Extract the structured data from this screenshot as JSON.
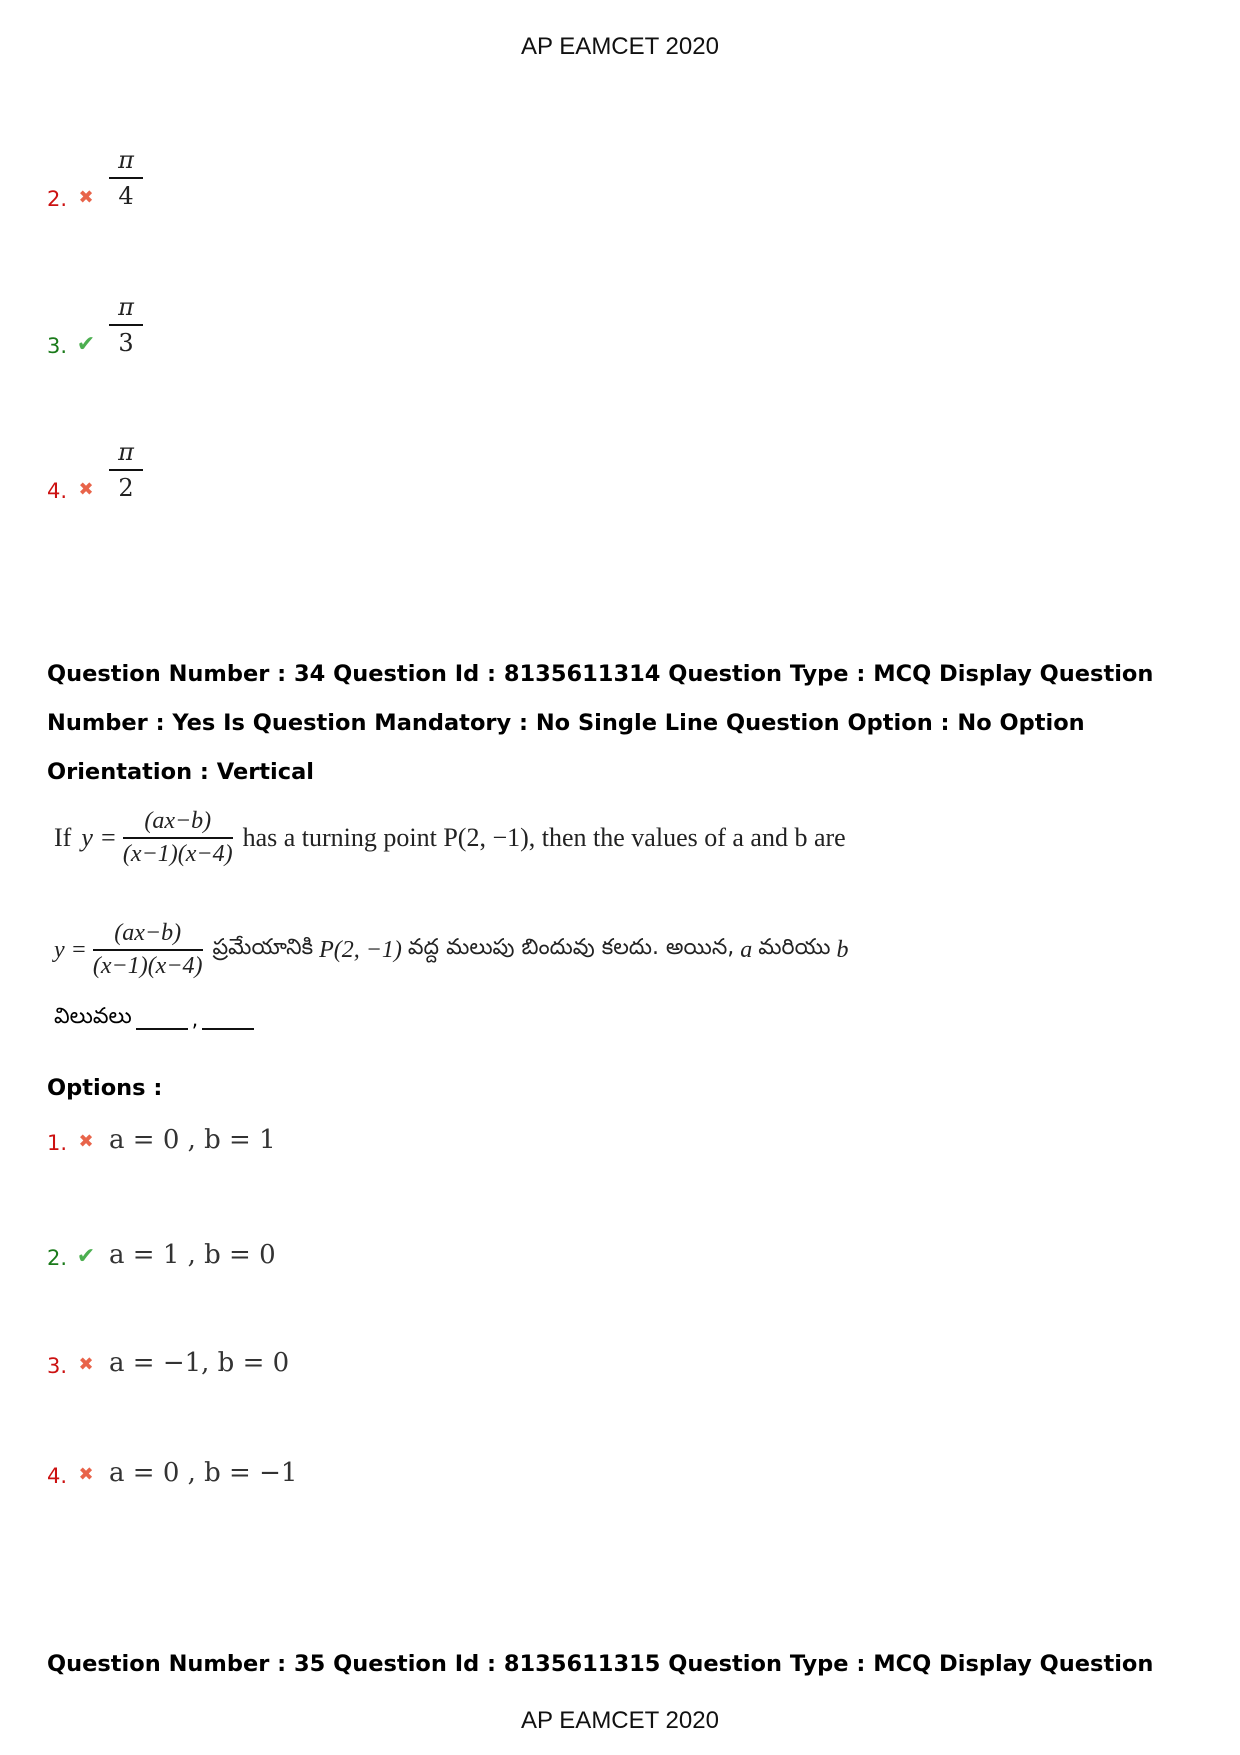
{
  "header": {
    "title": "AP EAMCET 2020"
  },
  "footer": {
    "title": "AP EAMCET 2020"
  },
  "prev_question_options": [
    {
      "number": "2.",
      "status": "wrong",
      "numerator": "π",
      "denominator": "4"
    },
    {
      "number": "3.",
      "status": "correct",
      "numerator": "π",
      "denominator": "3"
    },
    {
      "number": "4.",
      "status": "wrong",
      "numerator": "π",
      "denominator": "2"
    }
  ],
  "question34": {
    "meta_line1": "Question Number : 34 Question Id : 8135611314 Question Type : MCQ Display Question",
    "meta_line2": "Number : Yes Is Question Mandatory : No Single Line Question Option : No Option",
    "meta_line3": "Orientation : Vertical",
    "english": {
      "prefix": "If",
      "lhs": "y =",
      "numerator": "(ax−b)",
      "denominator": "(x−1)(x−4)",
      "suffix": "has a turning point P(2, −1), then the values of a and b are"
    },
    "telugu": {
      "lhs": "y =",
      "numerator": "(ax−b)",
      "denominator": "(x−1)(x−4)",
      "text1": "ప్రమేయానికి",
      "point": "P(2, −1)",
      "text2": "వద్ద మలుపు బిందువు కలదు. అయిన,",
      "a": "a",
      "text3": "మరియు",
      "b": "b",
      "line2": "విలువలు"
    },
    "options_label": "Options :",
    "options": [
      {
        "number": "1.",
        "status": "wrong",
        "text": "a = 0 , b = 1"
      },
      {
        "number": "2.",
        "status": "correct",
        "text": "a = 1 , b = 0"
      },
      {
        "number": "3.",
        "status": "wrong",
        "text": "a = −1, b = 0"
      },
      {
        "number": "4.",
        "status": "wrong",
        "text": "a = 0 , b = −1"
      }
    ]
  },
  "question35": {
    "meta_line1": "Question Number : 35 Question Id : 8135611315 Question Type : MCQ Display Question"
  },
  "icons": {
    "wrong": "✖",
    "correct": "✔"
  },
  "colors": {
    "wrong_number": "#cc1111",
    "correct_number": "#1a7a1a",
    "cross": "#e8644a",
    "check": "#4caf50"
  }
}
